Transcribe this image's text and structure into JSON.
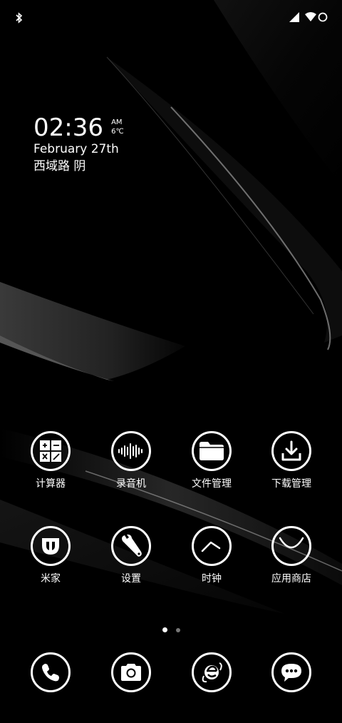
{
  "clock": {
    "time": "02:36",
    "ampm": "AM",
    "temperature": "6℃",
    "date": "February 27th",
    "location_weather": "西域路 阴"
  },
  "apps_row1": [
    {
      "label": "计算器",
      "icon": "calculator-icon"
    },
    {
      "label": "录音机",
      "icon": "sound-recorder-icon"
    },
    {
      "label": "文件管理",
      "icon": "folder-icon"
    },
    {
      "label": "下载管理",
      "icon": "download-icon"
    }
  ],
  "apps_row2": [
    {
      "label": "米家",
      "icon": "mijia-icon"
    },
    {
      "label": "设置",
      "icon": "wrench-icon"
    },
    {
      "label": "时钟",
      "icon": "clock-icon"
    },
    {
      "label": "应用商店",
      "icon": "app-store-icon"
    }
  ],
  "dock": [
    {
      "icon": "phone-icon"
    },
    {
      "icon": "camera-icon"
    },
    {
      "icon": "browser-icon"
    },
    {
      "icon": "messages-icon"
    }
  ],
  "page_indicator": {
    "pages": 2,
    "current": 1
  },
  "colors": {
    "foreground": "#ffffff",
    "background": "#000000"
  }
}
